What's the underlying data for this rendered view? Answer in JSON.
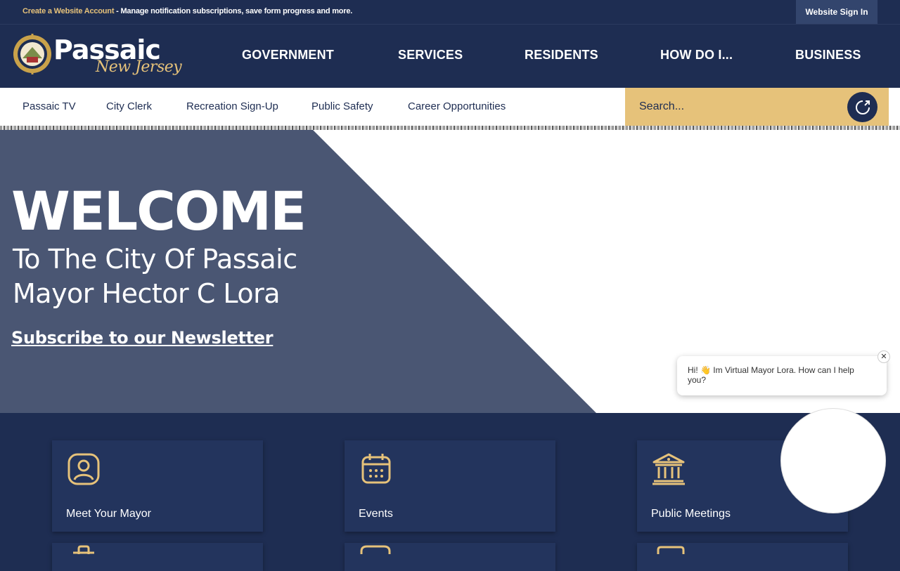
{
  "topbar": {
    "create_account_link": "Create a Website Account",
    "message": " - Manage notification subscriptions, save form progress and more.",
    "sign_in_label": "Website Sign In"
  },
  "logo": {
    "title": "Passaic",
    "subtitle": "New Jersey"
  },
  "main_nav": [
    "GOVERNMENT",
    "SERVICES",
    "RESIDENTS",
    "HOW DO I...",
    "BUSINESS"
  ],
  "sub_nav": [
    "Passaic TV",
    "City Clerk",
    "Recreation Sign-Up",
    "Public Safety",
    "Career Opportunities"
  ],
  "search": {
    "placeholder": "Search..."
  },
  "hero": {
    "heading": "WELCOME",
    "line1": "To The City Of Passaic",
    "line2": "Mayor Hector C Lora",
    "newsletter_link": "Subscribe to our Newsletter"
  },
  "cards": [
    {
      "label": "Meet Your Mayor",
      "icon": "user-profile-icon"
    },
    {
      "label": "Events",
      "icon": "calendar-icon"
    },
    {
      "label": "Public Meetings",
      "icon": "building-columns-icon"
    }
  ],
  "chat": {
    "greeting": "Hi! 👋 Im Virtual Mayor Lora. How can I help you?",
    "close_label": "✕"
  },
  "colors": {
    "navy": "#1e2d52",
    "gold": "#e6c27a",
    "slate": "#4a5673"
  }
}
